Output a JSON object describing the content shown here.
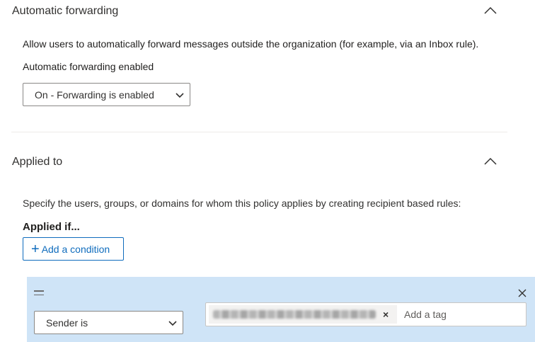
{
  "auto_forwarding": {
    "header": "Automatic forwarding",
    "description": "Allow users to automatically forward messages outside the organization (for example, via an Inbox rule).",
    "enabled_label": "Automatic forwarding enabled",
    "select_value": "On - Forwarding is enabled"
  },
  "applied_to": {
    "header": "Applied to",
    "description": "Specify the users, groups, or domains for whom this policy applies by creating recipient based rules:",
    "applied_if_label": "Applied if...",
    "add_condition_label": "Add a condition",
    "rule": {
      "condition_value": "Sender is",
      "tag_placeholder": "Add a tag",
      "tag_remove_glyph": "×"
    }
  },
  "icons": {
    "collapse": "chevron-up-icon",
    "add": "plus-icon",
    "drag": "grip-icon",
    "remove": "close-icon",
    "dropdown": "chevron-down-icon"
  },
  "colors": {
    "accent": "#0f6cbd",
    "rule_panel_bg": "#cfe4f7",
    "divider": "#edebe9"
  }
}
